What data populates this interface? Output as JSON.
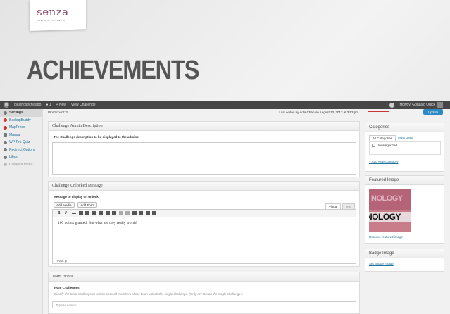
{
  "slide": {
    "logo": "senza",
    "logo_tagline": "strategic innovation",
    "title": "ACHIEVEMENTS"
  },
  "adminbar": {
    "site": "localhost/chicago",
    "comments": "1",
    "new": "New",
    "view": "View Challenge",
    "howdy": "Howdy, Gonzalo Quick"
  },
  "sidebar": {
    "items": [
      {
        "label": "Settings",
        "icon": "settings-icon"
      },
      {
        "label": "BackupBuddy",
        "icon": "backup-icon"
      },
      {
        "label": "MapPress",
        "icon": "map-pin-icon"
      },
      {
        "label": "Manual",
        "icon": "manual-icon"
      },
      {
        "label": "WP-Pro-Quiz",
        "icon": "quiz-icon"
      },
      {
        "label": "Redirect Options",
        "icon": "redirect-icon"
      },
      {
        "label": "Likes",
        "icon": "likes-icon"
      },
      {
        "label": "Collapse menu",
        "icon": "collapse-icon"
      }
    ]
  },
  "editor": {
    "word_count": "Word count: 3",
    "last_edited": "Last edited by Adia Chan on August 13, 2013 at 3:52 pm",
    "update_label": "Update"
  },
  "admin_desc": {
    "title": "Challenge Admin Description",
    "label": "The Challenge description to be displayed to the admins."
  },
  "unlocked": {
    "title": "Challenge Unlocked Message",
    "label": "Message to display on unlock",
    "add_media": "Add Media",
    "add_form": "Add Form",
    "tab_visual": "Visual",
    "tab_text": "Text",
    "toolbar_text_buttons": [
      "B",
      "I"
    ],
    "body": "100 points granted. But what are they really worth?",
    "path": "Path: p"
  },
  "team_bonus": {
    "title": "Team Bonus",
    "label": "Team Challenges:",
    "hint": "Specify the team challenge to unlock once all members of the team unlock this single challenge. (Only set this on the single challenge.)",
    "placeholder": "Type to search"
  },
  "categories": {
    "title": "Categories",
    "tab_all": "All Categories",
    "tab_most": "Most Used",
    "items": [
      "Uncategorized"
    ],
    "add_link": "+ Add New Category"
  },
  "featured": {
    "title": "Featured Image",
    "image_text_top": "NOLOGY",
    "image_text_bottom": "NOLOGY",
    "remove_link": "Remove featured image"
  },
  "badge": {
    "title": "Badge Image",
    "set_link": "Set Badge Image"
  }
}
